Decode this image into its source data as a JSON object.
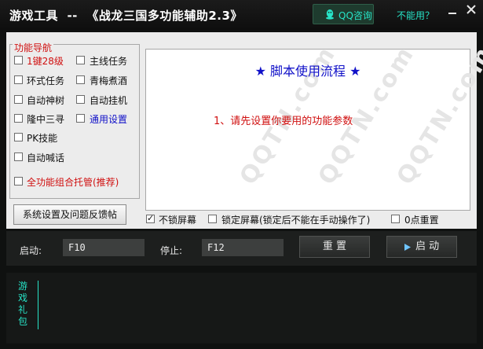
{
  "window": {
    "title": "游戏工具  --  《战龙三国多功能辅助2.3》",
    "qq_button": "QQ咨询",
    "help_link": "不能用？",
    "minimize_glyph": "—",
    "close_glyph": "✕"
  },
  "nav": {
    "legend": "功能导航",
    "items": [
      {
        "label": "1键28级",
        "checked": false,
        "color": "red"
      },
      {
        "label": "主线任务",
        "checked": false,
        "color": "black"
      },
      {
        "label": "环式任务",
        "checked": false,
        "color": "black"
      },
      {
        "label": "青梅煮酒",
        "checked": false,
        "color": "black"
      },
      {
        "label": "自动神树",
        "checked": false,
        "color": "black"
      },
      {
        "label": "自动挂机",
        "checked": false,
        "color": "black"
      },
      {
        "label": "隆中三寻",
        "checked": false,
        "color": "black"
      },
      {
        "label": "通用设置",
        "checked": false,
        "color": "blue"
      },
      {
        "label": "PK技能",
        "checked": false,
        "color": "black"
      },
      {
        "label": "自动喊话",
        "checked": false,
        "color": "black"
      },
      {
        "label": "全功能组合托管(推荐)",
        "checked": false,
        "color": "red"
      }
    ]
  },
  "info": {
    "title": "★ 脚本使用流程 ★",
    "line1": "1、请先设置你要用的功能参数",
    "watermark": "QQTN.com"
  },
  "feedback_button": "系统设置及问题反馈帖",
  "options": {
    "no_lock": {
      "label": "不锁屏幕",
      "checked": true
    },
    "lock": {
      "label": "锁定屏幕(锁定后不能在手动操作了)",
      "checked": false
    },
    "reset_zero": {
      "label": "0点重置",
      "checked": false
    }
  },
  "controls": {
    "start_label": "启动:",
    "start_key": "F10",
    "stop_label": "停止:",
    "stop_key": "F12",
    "reset_button": "重 置",
    "run_button": "启 动",
    "run_icon": "play-icon"
  },
  "gift": {
    "label": "游戏礼包"
  },
  "colors": {
    "accent": "#27e3c7",
    "red": "#d01010",
    "blue": "#1010c8",
    "dark_bg": "#0f1110"
  }
}
